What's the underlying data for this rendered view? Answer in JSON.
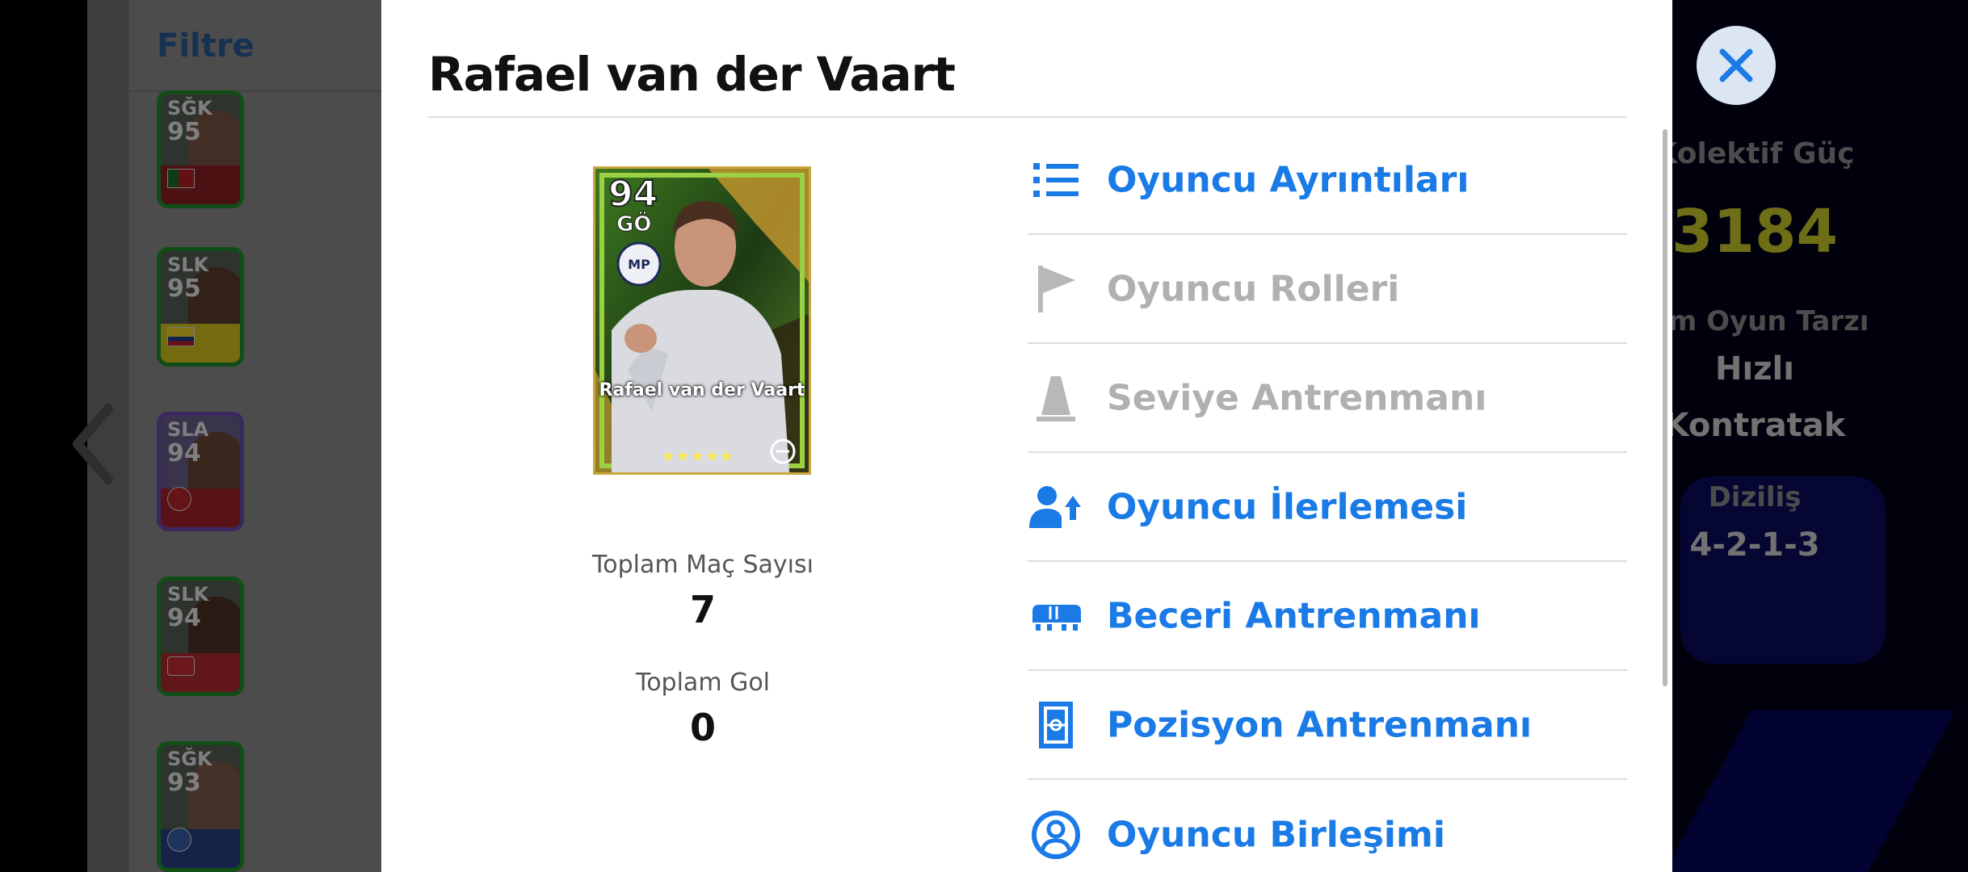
{
  "background": {
    "filter_label": "Filtre",
    "player_cards": [
      {
        "position": "SĞK",
        "rating": "95"
      },
      {
        "position": "SLK",
        "rating": "95"
      },
      {
        "position": "SLA",
        "rating": "94"
      },
      {
        "position": "SLK",
        "rating": "94"
      },
      {
        "position": "SĞK",
        "rating": "93"
      }
    ],
    "team_strength_label": "Kolektif Güç",
    "team_strength_value": "3184",
    "team_style_label": "kım Oyun Tarzı",
    "team_style_value_1": "Hızlı",
    "team_style_value_2": "Kontratak",
    "formation_label": "Diziliş",
    "formation_value": "4-2-1-3"
  },
  "modal": {
    "title": "Rafael van der Vaart",
    "card": {
      "rating": "94",
      "position": "GÖ",
      "name": "Rafael van der Vaart",
      "stars": "★★★★★"
    },
    "stats": {
      "matches_label": "Toplam Maç Sayısı",
      "matches_value": "7",
      "goals_label": "Toplam Gol",
      "goals_value": "0"
    },
    "menu": [
      {
        "label": "Oyuncu Ayrıntıları",
        "icon": "list-icon",
        "enabled": true
      },
      {
        "label": "Oyuncu Rolleri",
        "icon": "flag-icon",
        "enabled": false
      },
      {
        "label": "Seviye Antrenmanı",
        "icon": "cone-icon",
        "enabled": false
      },
      {
        "label": "Oyuncu İlerlemesi",
        "icon": "person-progress-icon",
        "enabled": true
      },
      {
        "label": "Beceri Antrenmanı",
        "icon": "boot-icon",
        "enabled": true
      },
      {
        "label": "Pozisyon Antrenmanı",
        "icon": "pitch-icon",
        "enabled": true
      },
      {
        "label": "Oyuncu Birleşimi",
        "icon": "person-circle-icon",
        "enabled": true
      }
    ]
  },
  "colors": {
    "accent_blue": "#1a7ae6",
    "disabled_gray": "#b0b0b0",
    "strength_yellow": "#c9c82a"
  }
}
